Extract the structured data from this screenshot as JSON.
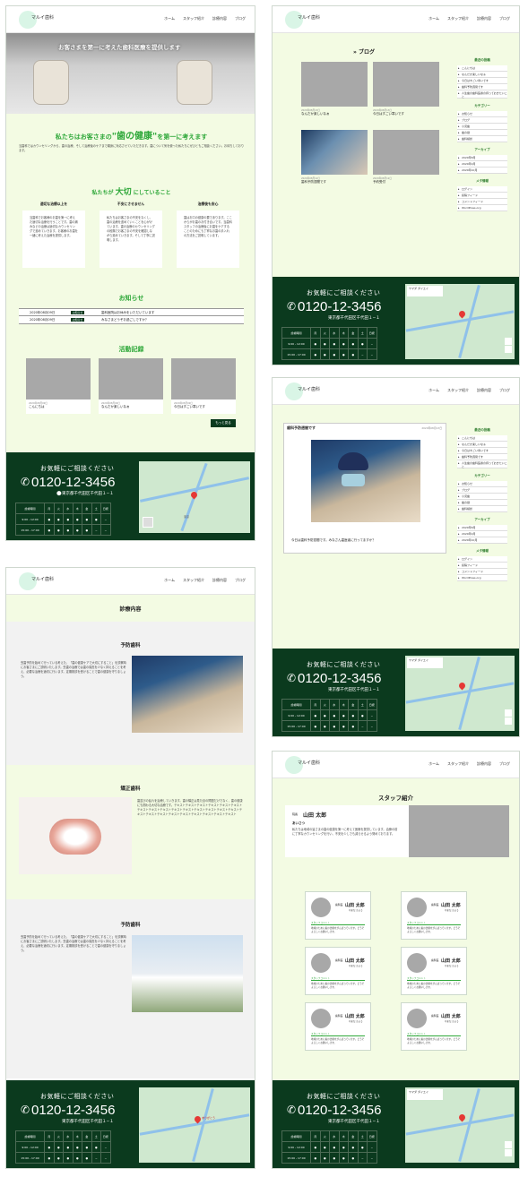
{
  "site": {
    "logo": "マルイ歯科",
    "nav": [
      "ホーム",
      "スタッフ紹介",
      "診療内容",
      "ブログ"
    ]
  },
  "home": {
    "hero_text": "お客さまを第一に考えた歯科医療を提供します",
    "title_pre": "私たちはお客さまの",
    "title_em": "\"歯の健康\"",
    "title_post": "を第一に考えます",
    "intro": "当歯科ではカウンセリングから、歯の治療、そして治療後のケアまで親身に対応させていただきます。歯について気を使った私たちにぜひともご相談ください。お待ちしております。",
    "important_pre": "私たちが",
    "important_em": "大切",
    "important_post": "にしていること",
    "features": [
      {
        "title": "適切な治療以上を",
        "text": "当歯科でお客様のお歯を第一に考えた適切な治療を行うことです。歯の痛みなどの治療は適切なカウンセリングで進めていきます。お客様のお歯を一緒に考えた治療を提供します。"
      },
      {
        "title": "不安にさせません",
        "text": "私たちはお客さまの不安をなくし、歯の治療を進めていくことを心がけています。歯の治療のカウンセリングの段階でお客さまの不安を確認しながら進めていきます。そして丁寧に説明します。"
      },
      {
        "title": "治療後も安心",
        "text": "歯はお口の健康の要であります。ここからがお歯のお付き合いです。当歯科スタッフの治療後にお歯をケアすることのためにも丁寧なお歯の手入れの方法をご説明しています。"
      }
    ],
    "news_title": "お知らせ",
    "news": [
      {
        "date": "2020年08月09日",
        "tag": "お知らせ",
        "text": "歯科医院はお休みをいただいています"
      },
      {
        "date": "2020年08月09日",
        "tag": "お知らせ",
        "text": "みなさまどうぞお過ごしですか？"
      }
    ],
    "activity_title": "活動記録",
    "activities": [
      {
        "date": "2020年08月09日",
        "title": "こんにちは"
      },
      {
        "date": "2020年08月09日",
        "title": "なんだか楽しいなぁ"
      },
      {
        "date": "2020年08月09日",
        "title": "今日はすごい寒いです"
      }
    ],
    "more_button": "もっと見る"
  },
  "footer": {
    "consult": "お気軽にご相談ください",
    "phone": "0120-12-3456",
    "address": "東京都千代田区千代田１−１",
    "schedule_header": [
      "診療時間",
      "月",
      "火",
      "水",
      "木",
      "金",
      "土",
      "日祝"
    ],
    "schedule_rows": [
      {
        "time": "9:00 - 12:00",
        "marks": [
          "●",
          "●",
          "●",
          "●",
          "●",
          "●",
          "−"
        ]
      },
      {
        "time": "15:00 - 17:00",
        "marks": [
          "●",
          "●",
          "●",
          "●",
          "●",
          "−",
          "−"
        ]
      }
    ],
    "map_pin": "ありがとう",
    "map_label": "東京",
    "map_place": "ヤマダ ダイエイ"
  },
  "blog": {
    "title": "» ブログ",
    "posts": [
      {
        "date": "2020年08月13日",
        "title": "なんだか楽しいなぁ"
      },
      {
        "date": "2020年08月13日",
        "title": "今日はすごい寒いです"
      },
      {
        "date": "2020年08月12日",
        "title": "歯科予防週間です"
      },
      {
        "date": "2020年08月12日",
        "title": "予約受付"
      }
    ]
  },
  "sidebar": {
    "recent_title": "最近の投稿",
    "recent": [
      "こんにちは",
      "なんだか楽しいなぁ",
      "今日はすごい寒いです",
      "歯科予防週間です",
      "人生歯の歯科医療の持っておきたいこと"
    ],
    "category_title": "カテゴリー",
    "categories": [
      "お知らせ",
      "ブログ",
      "小児歯",
      "歯の健",
      "歯科検診"
    ],
    "archive_title": "アーカイブ",
    "archives": [
      "2020年8月",
      "2020年9月",
      "2020年10月"
    ],
    "meta_title": "メタ情報",
    "meta": [
      "ログイン",
      "投稿フィード",
      "コメントフィード",
      "WordPress.org"
    ]
  },
  "post": {
    "title": "歯科予防週間です",
    "date": "2020年08月13日",
    "body": "今日は歯科予防週間です。みなさん歯医者に行ってますか？"
  },
  "services": {
    "title": "診療内容",
    "items": [
      {
        "title": "予防歯科",
        "text": "虫歯予防を始めて行っている考えた、「歯の健康ケアで大切にすること」を診察時にお客さまにご説明いたします。虫歯の治療では歯の負担を少なく抑えることを考え、必要な治療を適切に行います。定期検診を受けることで歯の健康を守りましょう。"
      },
      {
        "title": "矯正歯科",
        "text": "歯並びの乱れを治療していきます。歯の矯正は見た目の問題だけでなく、歯の健康にも関わる大切な治療です。テキストテキストテキストテキストテキストテキストテキストテキストテキストテキストテキストテキストテキストテキストテキストテキストテキストテキストテキストテキストテキストテキストテキストテキスト"
      },
      {
        "title": "予防歯科",
        "text": "虫歯予防を始めて行っている考えた、「歯の健康ケアで大切にすること」を診察時にお客さまにご説明いたします。虫歯の治療では歯の負担を少なく抑えることを考え、必要な治療を適切に行います。定期検診を受けることで歯の健康を守りましょう。"
      }
    ]
  },
  "staff": {
    "title": "スタッフ紹介",
    "director_role": "院長",
    "director_name": "山田 太郎",
    "director_greet": "あいさつ",
    "director_text": "私たちは地域の皆さまの歯の健康を第一に考えて医療を提供しています。治療の前に丁寧なカウンセリングを行い、不安を少しでも減らせるよう努めております。",
    "members": [
      {
        "pos": "歯科医",
        "name": "山田 太郎",
        "kana": "やまだ たろう",
        "role": "スタッフコメント",
        "msg": "地域のために歯の治療をがんばっています。どうぞよろしくお願いします。"
      },
      {
        "pos": "歯科医",
        "name": "山田 太郎",
        "kana": "やまだ たろう",
        "role": "スタッフコメント",
        "msg": "地域のために歯の治療をがんばっています。どうぞよろしくお願いします。"
      },
      {
        "pos": "歯科医",
        "name": "山田 太郎",
        "kana": "やまだ たろう",
        "role": "スタッフコメント",
        "msg": "地域のために歯の治療をがんばっています。どうぞよろしくお願いします。"
      },
      {
        "pos": "歯科医",
        "name": "山田 太郎",
        "kana": "やまだ たろう",
        "role": "スタッフコメント",
        "msg": "地域のために歯の治療をがんばっています。どうぞよろしくお願いします。"
      },
      {
        "pos": "歯科医",
        "name": "山田 太郎",
        "kana": "やまだ たろう",
        "role": "スタッフコメント",
        "msg": "地域のために歯の治療をがんばっています。どうぞよろしくお願いします。"
      },
      {
        "pos": "歯科医",
        "name": "山田 太郎",
        "kana": "やまだ たろう",
        "role": "スタッフコメント",
        "msg": "地域のために歯の治療をがんばっています。どうぞよろしくお願いします。"
      }
    ]
  }
}
